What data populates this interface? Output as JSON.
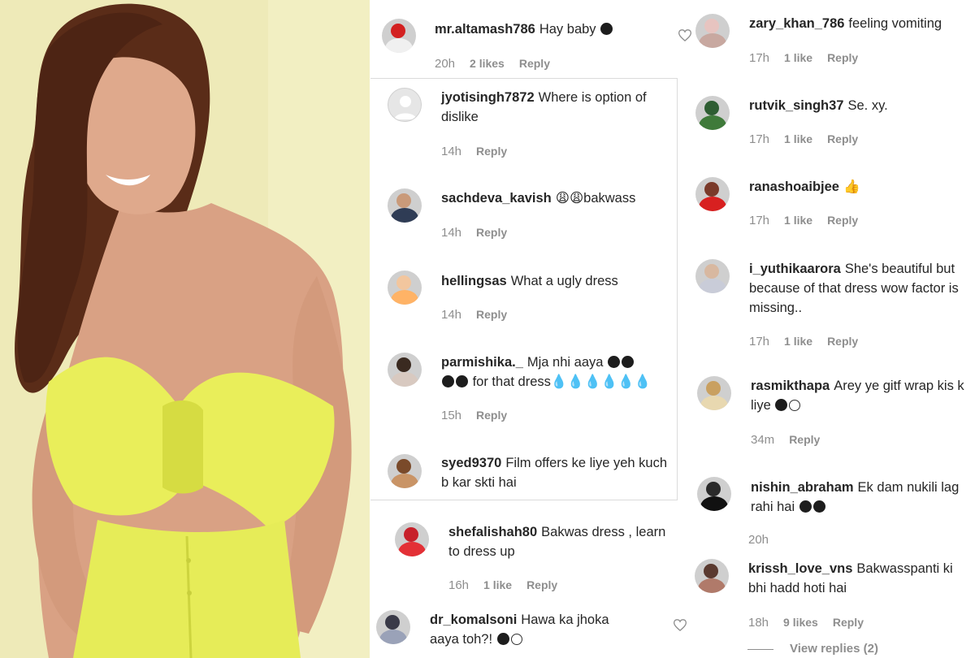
{
  "left_comments": [
    {
      "user": "mr.altamash786",
      "text": "Hay baby",
      "emoji": "dark",
      "time": "20h",
      "likes": "2 likes",
      "reply": "Reply",
      "heart": true,
      "avatar": {
        "a": "#d32020",
        "b": "#f0f0f0"
      }
    },
    {
      "user": "jyotisingh7872",
      "text": "Where is option of dislike",
      "time": "14h",
      "likes": "",
      "reply": "Reply",
      "placeholder": true
    },
    {
      "user": "sachdeva_kavish",
      "text": "😩😩bakwass",
      "time": "14h",
      "likes": "",
      "reply": "Reply",
      "avatar": {
        "a": "#c99a7a",
        "b": "#2f3c55"
      }
    },
    {
      "user": "hellingsas",
      "text": "What a ugly dress",
      "time": "14h",
      "likes": "",
      "reply": "Reply",
      "avatar": {
        "a": "#f2c69e",
        "b": "#ffb366"
      }
    },
    {
      "user": "parmishika._",
      "text": "Mja nhi aaya",
      "text2": "for that dress💧💧💧💧💧💧",
      "time": "15h",
      "likes": "",
      "reply": "Reply",
      "avatar": {
        "a": "#3a2a20",
        "b": "#d8c9c0"
      }
    },
    {
      "user": "syed9370",
      "text": "Film offers ke liye yeh kuch b kar skti hai",
      "time": "",
      "likes": "",
      "reply": "",
      "avatar": {
        "a": "#7a4a2a",
        "b": "#c99466"
      }
    },
    {
      "user": "shefalishah80",
      "text": "Bakwas dress , learn to dress up",
      "time": "16h",
      "likes": "1 like",
      "reply": "Reply",
      "avatar": {
        "a": "#c7202a",
        "b": "#e33036"
      }
    },
    {
      "user": "dr_komalsoni",
      "text": "Hawa ka jhoka aaya toh?!",
      "time": "",
      "likes": "",
      "reply": "",
      "heart": true,
      "avatar": {
        "a": "#3a3a48",
        "b": "#9aa2b8"
      }
    }
  ],
  "right_comments": [
    {
      "user": "zary_khan_786",
      "text": "feeling vomiting",
      "time": "17h",
      "likes": "1 like",
      "reply": "Reply",
      "avatar": {
        "a": "#e7c4c0",
        "b": "#c8a8a0"
      }
    },
    {
      "user": "rutvik_singh37",
      "text": "Se. xy.",
      "time": "17h",
      "likes": "1 like",
      "reply": "Reply",
      "avatar": {
        "a": "#2e5d32",
        "b": "#3f7a3a"
      }
    },
    {
      "user": "ranashoaibjee",
      "text": "👍",
      "time": "17h",
      "likes": "1 like",
      "reply": "Reply",
      "avatar": {
        "a": "#7a3a2a",
        "b": "#d82020"
      }
    },
    {
      "user": "i_yuthikaarora",
      "text": "She's beautiful but because of that dress wow factor is missing..",
      "time": "17h",
      "likes": "1 like",
      "reply": "Reply",
      "avatar": {
        "a": "#d8b8a0",
        "b": "#c9ccd8"
      }
    },
    {
      "user": "rasmikthapa",
      "text": "Arey ye gitf wrap kis k liye",
      "time": "34m",
      "likes": "",
      "reply": "Reply",
      "avatar": {
        "a": "#c9a060",
        "b": "#e8d8b0"
      }
    },
    {
      "user": "nishin_abraham",
      "text": "Ek dam nukili lag rahi hai",
      "time": "20h",
      "likes": "",
      "reply": "",
      "avatar": {
        "a": "#2a2a2a",
        "b": "#111111"
      }
    },
    {
      "user": "krissh_love_vns",
      "text": "Bakwasspanti ki bhi hadd hoti hai",
      "time": "18h",
      "likes": "9 likes",
      "reply": "Reply",
      "avatar": {
        "a": "#5a3a30",
        "b": "#b07a6a"
      }
    }
  ],
  "view_replies": "View replies (2)"
}
